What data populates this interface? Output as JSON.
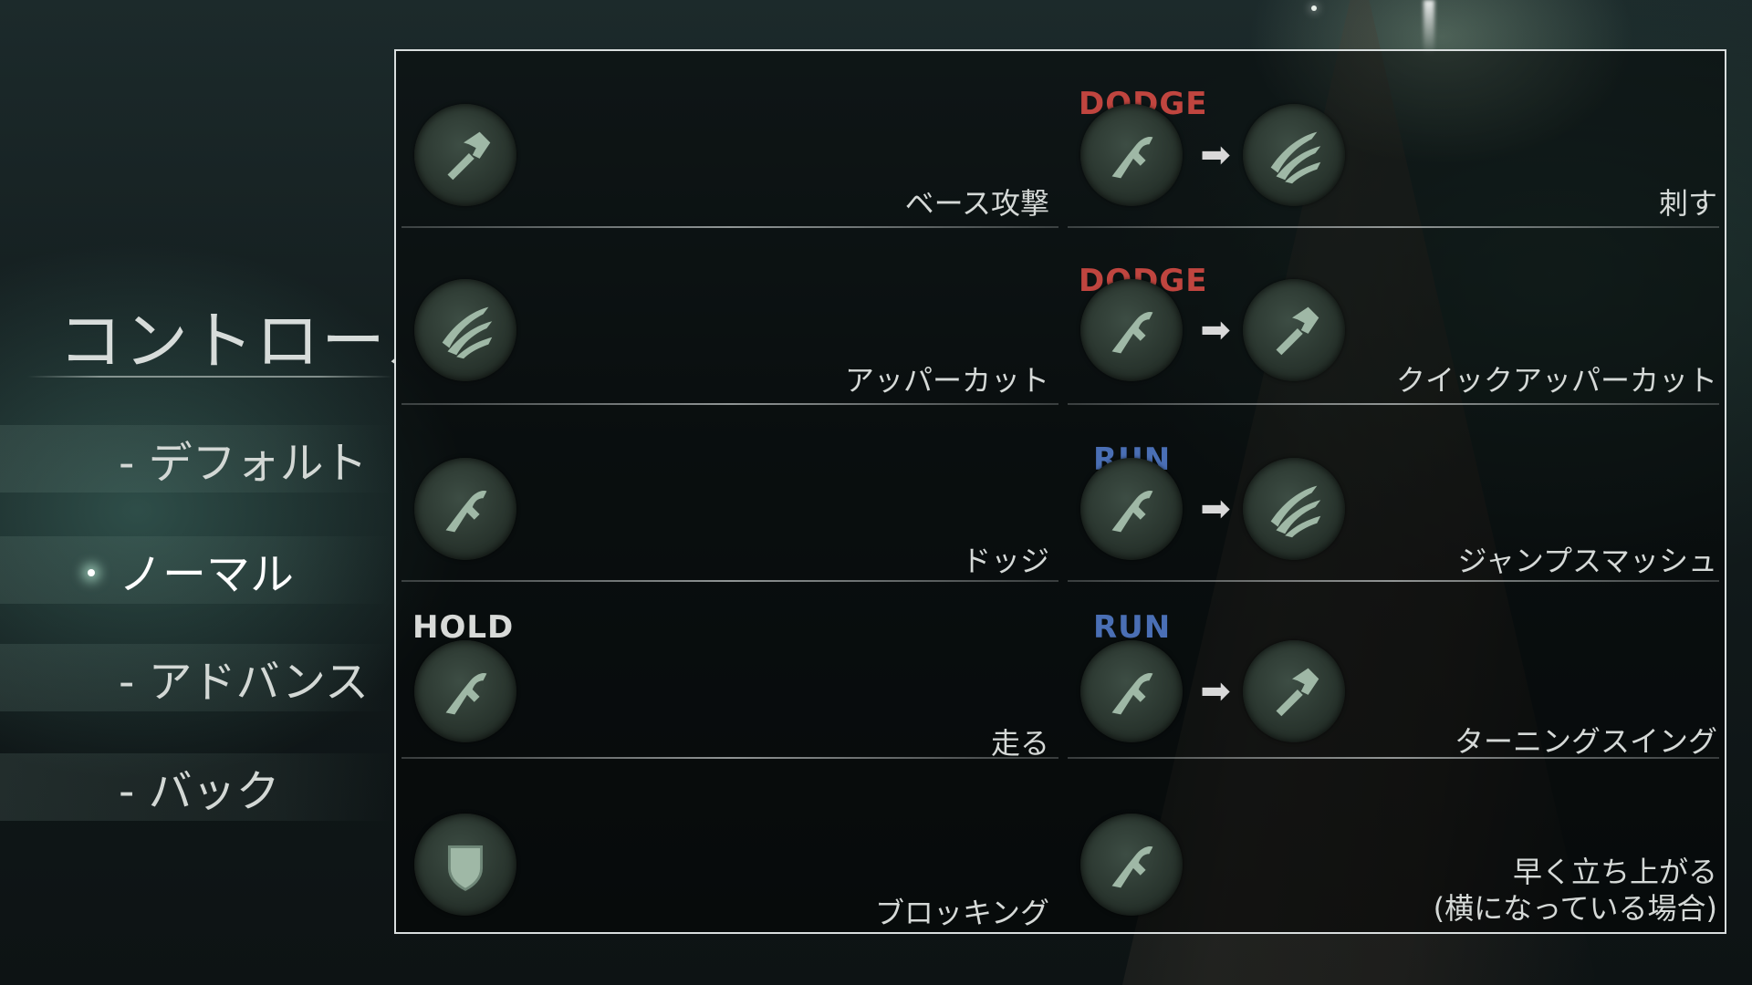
{
  "menu": {
    "title": "コントロール",
    "items": [
      {
        "label": "- デフォルト"
      },
      {
        "label": "ノーマル"
      },
      {
        "label": "- アドバンス"
      },
      {
        "label": "- バック"
      }
    ]
  },
  "rows": [
    {
      "left_label": "ベース攻撃",
      "combo_tag": "DODGE",
      "right_label": "刺す"
    },
    {
      "left_label": "アッパーカット",
      "combo_tag": "DODGE",
      "right_label": "クイックアッパーカット"
    },
    {
      "left_label": "ドッジ",
      "combo_tag": "RUN",
      "right_label": "ジャンプスマッシュ"
    },
    {
      "left_label": "走る",
      "left_tag": "HOLD",
      "combo_tag": "RUN",
      "right_label": "ターニングスイング"
    },
    {
      "left_label": "ブロッキング",
      "right_label": "早く立ち上がる\n(横になっている場合)"
    }
  ],
  "colors": {
    "dodge": "#c0453f",
    "run": "#4a6fb5",
    "hold": "#d8dad8",
    "icon_fill": "#9fb8a6"
  },
  "icons": {
    "attack": "hammer-icon",
    "uppercut": "claw-icon",
    "dodge": "dash-icon",
    "block": "shield-icon"
  }
}
